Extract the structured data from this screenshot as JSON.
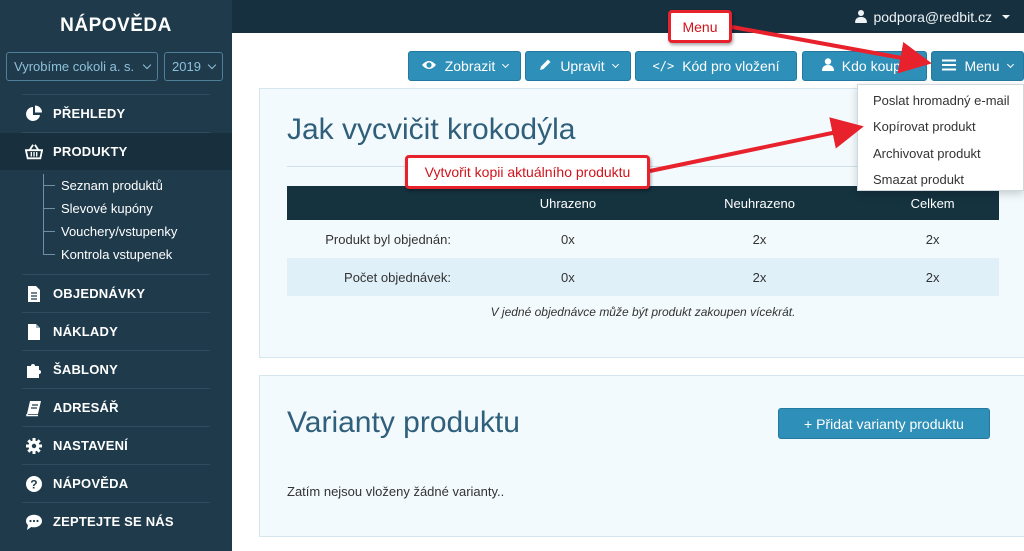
{
  "sidebar": {
    "brand": "NÁPOVĚDA",
    "company": "Vyrobíme cokoli a. s.",
    "year": "2019",
    "items": [
      {
        "label": "PŘEHLEDY",
        "icon": "pie-chart-icon"
      },
      {
        "label": "PRODUKTY",
        "icon": "basket-icon"
      },
      {
        "label": "OBJEDNÁVKY",
        "icon": "document-icon"
      },
      {
        "label": "NÁKLADY",
        "icon": "file-icon"
      },
      {
        "label": "ŠABLONY",
        "icon": "puzzle-icon"
      },
      {
        "label": "ADRESÁŘ",
        "icon": "book-icon"
      },
      {
        "label": "NASTAVENÍ",
        "icon": "gear-icon"
      },
      {
        "label": "NÁPOVĚDA",
        "icon": "question-icon"
      },
      {
        "label": "ZEPTEJTE SE NÁS",
        "icon": "chat-icon"
      }
    ],
    "subitems": [
      "Seznam produktů",
      "Slevové kupóny",
      "Vouchery/vstupenky",
      "Kontrola vstupenek"
    ]
  },
  "topbar": {
    "user": "podpora@redbit.cz"
  },
  "toolbar": {
    "view": "Zobrazit",
    "edit": "Upravit",
    "embed": "Kód pro vložení",
    "buyers": "Kdo koupil",
    "menu": "Menu"
  },
  "dropdown": [
    "Poslat hromadný e-mail",
    "Kopírovat produkt",
    "Archivovat produkt",
    "Smazat produkt"
  ],
  "product": {
    "title": "Jak vycvičit krokodýla",
    "table": {
      "headers": [
        "",
        "Uhrazeno",
        "Neuhrazeno",
        "Celkem"
      ],
      "rows": [
        [
          "Produkt byl objednán:",
          "0x",
          "2x",
          "2x"
        ],
        [
          "Počet objednávek:",
          "0x",
          "2x",
          "2x"
        ]
      ]
    },
    "note": "V jedné objednávce může být produkt zakoupen vícekrát."
  },
  "variants": {
    "title": "Varianty produktu",
    "add_button": "+ Přidat varianty produktu",
    "empty": "Zatím nejsou vloženy žádné varianty.."
  },
  "annotations": {
    "menu": "Menu",
    "copy": "Vytvořit kopii aktuálního produktu"
  },
  "colors": {
    "sidebar": "#1e3a4b",
    "accent": "#2e8fb8",
    "annotation": "#e8222c"
  }
}
